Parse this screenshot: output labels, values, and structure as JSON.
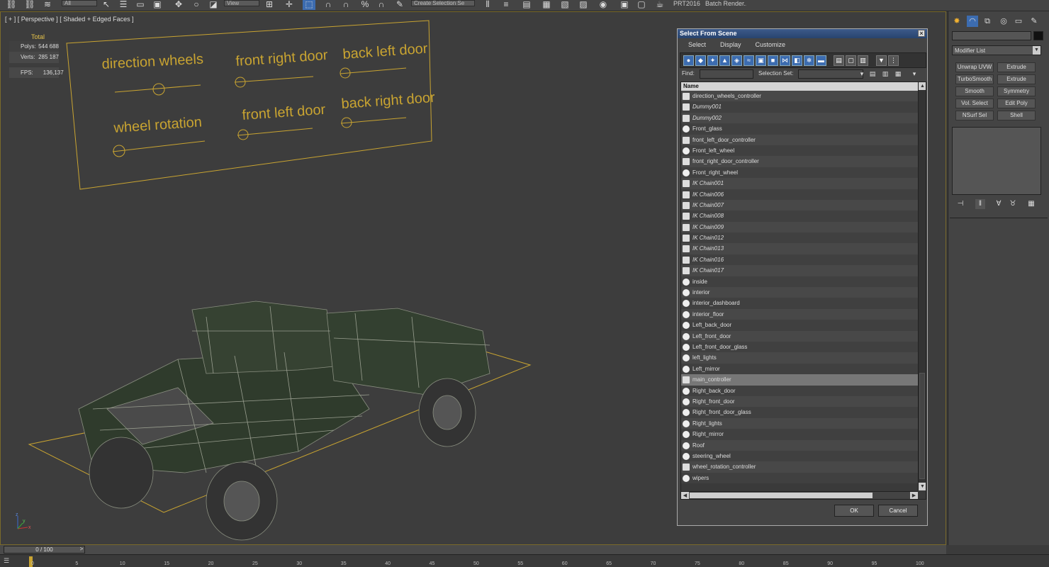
{
  "toolbar": {
    "selection_filter": "All",
    "ref_coord": "View",
    "selection_set": "Create Selection Se",
    "icons": [
      "link-icon",
      "unlink-icon",
      "bind-space-warp-icon",
      "select-icon",
      "select-by-name-icon",
      "rect-select-icon",
      "window-crossing-icon",
      "move-icon",
      "rotate-icon",
      "scale-icon",
      "pivot-icon",
      "mirror-icon",
      "align-icon",
      "layers-icon",
      "graphite-icon",
      "curve-editor-icon",
      "schematic-icon",
      "material-editor-icon",
      "render-setup-icon",
      "rendered-frame-icon",
      "render-icon"
    ],
    "label_prt": "PRT2016",
    "label_batch": "Batch Render..."
  },
  "viewport": {
    "label": "[ + ] [ Perspective ] [ Shaded + Edged Faces ]",
    "stats": {
      "header": "Total",
      "polys_label": "Polys:",
      "polys_value": "544 688",
      "verts_label": "Verts:",
      "verts_value": "285 187",
      "fps_label": "FPS:",
      "fps_value": "136,137"
    },
    "panel_labels": [
      "direction wheels",
      "front right door",
      "back left door",
      "wheel rotation",
      "front left door",
      "back right door"
    ],
    "axis": {
      "x": "x",
      "y": "y",
      "z": "z"
    }
  },
  "dialog": {
    "title": "Select From Scene",
    "close": "×",
    "menu": [
      "Select",
      "Display",
      "Customize"
    ],
    "find_label": "Find:",
    "find_value": "",
    "selection_set_label": "Selection Set:",
    "selection_set_value": "",
    "column_name": "Name",
    "items": [
      {
        "name": "direction_wheels_controller",
        "italic": false,
        "icon": "helper"
      },
      {
        "name": "Dummy001",
        "italic": true,
        "icon": "dummy"
      },
      {
        "name": "Dummy002",
        "italic": true,
        "icon": "dummy"
      },
      {
        "name": "Front_glass",
        "italic": false,
        "icon": "geometry"
      },
      {
        "name": "front_left_door_controller",
        "italic": false,
        "icon": "helper"
      },
      {
        "name": "Front_left_wheel",
        "italic": false,
        "icon": "geometry"
      },
      {
        "name": "front_right_door_controller",
        "italic": false,
        "icon": "helper"
      },
      {
        "name": "Front_right_wheel",
        "italic": false,
        "icon": "geometry"
      },
      {
        "name": "IK Chain001",
        "italic": true,
        "icon": "dummy"
      },
      {
        "name": "IK Chain006",
        "italic": true,
        "icon": "dummy"
      },
      {
        "name": "IK Chain007",
        "italic": true,
        "icon": "dummy"
      },
      {
        "name": "IK Chain008",
        "italic": true,
        "icon": "dummy"
      },
      {
        "name": "IK Chain009",
        "italic": true,
        "icon": "dummy"
      },
      {
        "name": "IK Chain012",
        "italic": true,
        "icon": "dummy"
      },
      {
        "name": "IK Chain013",
        "italic": true,
        "icon": "dummy"
      },
      {
        "name": "IK Chain016",
        "italic": true,
        "icon": "dummy"
      },
      {
        "name": "IK Chain017",
        "italic": true,
        "icon": "dummy"
      },
      {
        "name": "inside",
        "italic": false,
        "icon": "geometry"
      },
      {
        "name": "interior",
        "italic": false,
        "icon": "geometry"
      },
      {
        "name": "interior_dashboard",
        "italic": false,
        "icon": "geometry"
      },
      {
        "name": "interior_floor",
        "italic": false,
        "icon": "geometry"
      },
      {
        "name": "Left_back_door",
        "italic": false,
        "icon": "geometry"
      },
      {
        "name": "Left_front_door",
        "italic": false,
        "icon": "geometry"
      },
      {
        "name": "Left_front_door_glass",
        "italic": false,
        "icon": "geometry"
      },
      {
        "name": "left_lights",
        "italic": false,
        "icon": "geometry"
      },
      {
        "name": "Left_mirror",
        "italic": false,
        "icon": "geometry"
      },
      {
        "name": "main_controller",
        "italic": false,
        "icon": "helper",
        "selected": true
      },
      {
        "name": "Right_back_door",
        "italic": false,
        "icon": "geometry"
      },
      {
        "name": "Right_front_door",
        "italic": false,
        "icon": "geometry"
      },
      {
        "name": "Right_front_door_glass",
        "italic": false,
        "icon": "geometry"
      },
      {
        "name": "Right_lights",
        "italic": false,
        "icon": "geometry"
      },
      {
        "name": "Right_mirror",
        "italic": false,
        "icon": "geometry"
      },
      {
        "name": "Roof",
        "italic": false,
        "icon": "geometry"
      },
      {
        "name": "steering_wheel",
        "italic": false,
        "icon": "geometry"
      },
      {
        "name": "wheel_rotation_controller",
        "italic": false,
        "icon": "helper"
      },
      {
        "name": "wipers",
        "italic": false,
        "icon": "geometry"
      }
    ],
    "ok_label": "OK",
    "cancel_label": "Cancel"
  },
  "command_panel": {
    "modifier_list": "Modifier List",
    "modifier_buttons": [
      "Unwrap UVW",
      "Extrude",
      "TurboSmooth",
      "Extrude",
      "Smooth",
      "Symmetry",
      "Vol. Select",
      "Edit Poly",
      "NSurf Sel",
      "Shell"
    ],
    "name_value": ""
  },
  "timeline": {
    "frame_display": "0 / 100",
    "ticks": [
      "0",
      "5",
      "10",
      "15",
      "20",
      "25",
      "30",
      "35",
      "40",
      "45",
      "50",
      "55",
      "60",
      "65",
      "70",
      "75",
      "80",
      "85",
      "90",
      "95",
      "100"
    ]
  },
  "colors": {
    "accent_yellow": "#c9a431",
    "viewport_bg": "#3d3d3d",
    "dialog_title": "#28446e",
    "selected_row": "#777777"
  }
}
